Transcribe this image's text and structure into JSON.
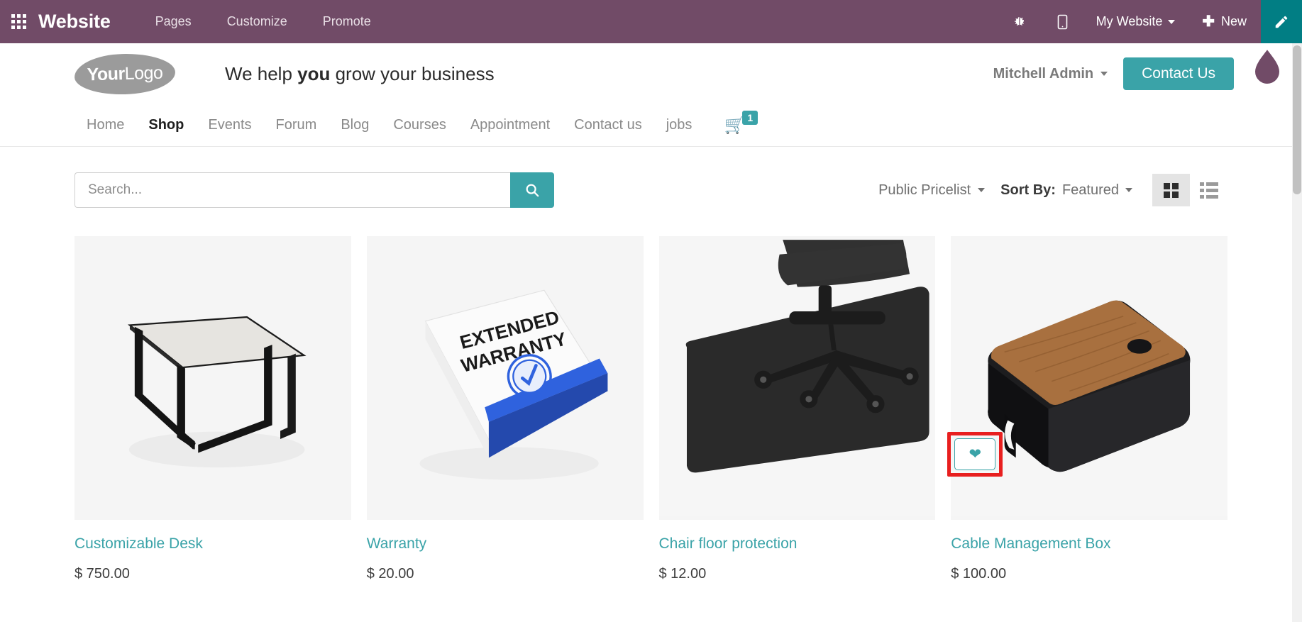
{
  "theme": {
    "odoo_purple": "#714B67",
    "teal_accent": "#3aa3a8",
    "edit_teal": "#017e84",
    "annotation_red": "#e81f1f"
  },
  "odoo_bar": {
    "apps_icon": "apps-grid-icon",
    "brand": "Website",
    "menus": [
      {
        "label": "Pages"
      },
      {
        "label": "Customize"
      },
      {
        "label": "Promote"
      }
    ],
    "debug_icon": "bug-icon",
    "mobile_icon": "mobile-preview-icon",
    "website_selector": "My Website",
    "new_label": "New",
    "plus_icon": "plus-icon",
    "edit_icon": "edit-pencil-icon"
  },
  "site_header": {
    "logo_bold": "Your",
    "logo_light": "Logo",
    "tagline_pre": "We help ",
    "tagline_bold": "you",
    "tagline_post": " grow your business",
    "user_name": "Mitchell Admin",
    "contact_button": "Contact Us",
    "theme_icon": "theme-droplet-icon"
  },
  "site_nav": {
    "items": [
      {
        "label": "Home",
        "active": false
      },
      {
        "label": "Shop",
        "active": true
      },
      {
        "label": "Events",
        "active": false
      },
      {
        "label": "Forum",
        "active": false
      },
      {
        "label": "Blog",
        "active": false
      },
      {
        "label": "Courses",
        "active": false
      },
      {
        "label": "Appointment",
        "active": false
      },
      {
        "label": "Contact us",
        "active": false
      },
      {
        "label": "jobs",
        "active": false
      }
    ],
    "cart_icon": "shopping-cart-icon",
    "cart_count": "1"
  },
  "toolbar": {
    "search_placeholder": "Search...",
    "search_value": "",
    "search_icon": "search-icon",
    "pricelist_label": "Public Pricelist",
    "sort_prefix": "Sort By:",
    "sort_value": "Featured",
    "grid_view_icon": "grid-view-icon",
    "list_view_icon": "list-view-icon",
    "active_view": "grid"
  },
  "products": [
    {
      "name": "Customizable Desk",
      "price": "$ 750.00",
      "art": "desk",
      "wishlisted": false,
      "highlighted": false
    },
    {
      "name": "Warranty",
      "price": "$ 20.00",
      "art": "warranty",
      "box_line1": "EXTENDED",
      "box_line2": "WARRANTY",
      "wishlisted": false,
      "highlighted": false
    },
    {
      "name": "Chair floor protection",
      "price": "$ 12.00",
      "art": "mat",
      "wishlisted": false,
      "highlighted": false
    },
    {
      "name": "Cable Management Box",
      "price": "$ 100.00",
      "art": "cable",
      "wishlist_icon": "heart-icon",
      "wishlisted": true,
      "highlighted": true
    }
  ]
}
